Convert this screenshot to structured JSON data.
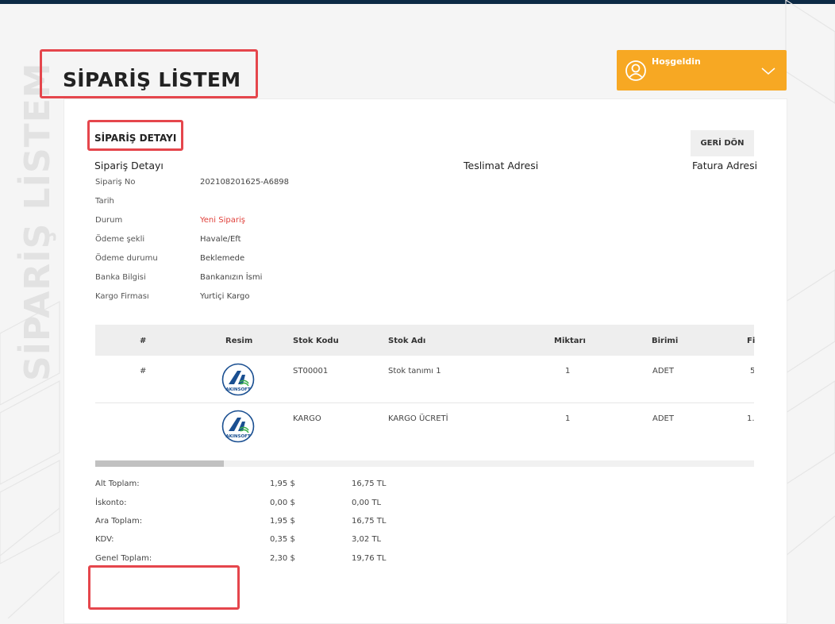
{
  "page": {
    "side_title": "SİPARİŞ LİSTEM",
    "title": "SİPARİŞ LİSTEM"
  },
  "user_menu": {
    "greeting": "Hoşgeldin",
    "icons": [
      "user-circle-icon",
      "chevron-down-icon"
    ]
  },
  "order": {
    "section_title": "SİPARİŞ DETAYI",
    "back_button": "GERİ DÖN",
    "columns": {
      "detail": "Sipariş Detayı",
      "shipping": "Teslimat Adresi",
      "billing": "Fatura Adresi"
    },
    "info": [
      {
        "label": "Sipariş No",
        "value": "202108201625-A6898"
      },
      {
        "label": "Tarih",
        "value": ""
      },
      {
        "label": "Durum",
        "value": "Yeni Sipariş"
      },
      {
        "label": "Ödeme şekli",
        "value": "Havale/Eft"
      },
      {
        "label": "Ödeme durumu",
        "value": "Beklemede"
      },
      {
        "label": "Banka Bilgisi",
        "value": "Bankanızın İsmi"
      },
      {
        "label": "Kargo Firması",
        "value": "Yurtiçi Kargo"
      }
    ],
    "status_color": "#e0403a"
  },
  "items_table": {
    "headers": [
      "#",
      "Resim",
      "Stok Kodu",
      "Stok Adı",
      "Miktarı",
      "Birimi",
      "Fi"
    ],
    "rows": [
      {
        "num": "#",
        "image": "akinsoft-logo",
        "code": "ST00001",
        "name": "Stok tanımı 1",
        "qty": "1",
        "unit": "ADET",
        "price": "5"
      },
      {
        "num": "",
        "image": "akinsoft-logo",
        "code": "KARGO",
        "name": "KARGO ÜCRETİ",
        "qty": "1",
        "unit": "ADET",
        "price": "1."
      }
    ],
    "logo_text": "AKINSOFT"
  },
  "totals": [
    {
      "label": "Alt Toplam:",
      "usd": "1,95 $",
      "tl": "16,75 TL"
    },
    {
      "label": "İskonto:",
      "usd": "0,00 $",
      "tl": "0,00 TL"
    },
    {
      "label": "Ara Toplam:",
      "usd": "1,95 $",
      "tl": "16,75 TL"
    },
    {
      "label": "KDV:",
      "usd": "0,35 $",
      "tl": "3,02 TL"
    },
    {
      "label": "Genel Toplam:",
      "usd": "2,30 $",
      "tl": "19,76 TL"
    }
  ],
  "colors": {
    "accent": "#f7a823",
    "highlight": "#e5464c",
    "topbar": "#0d2a45"
  }
}
